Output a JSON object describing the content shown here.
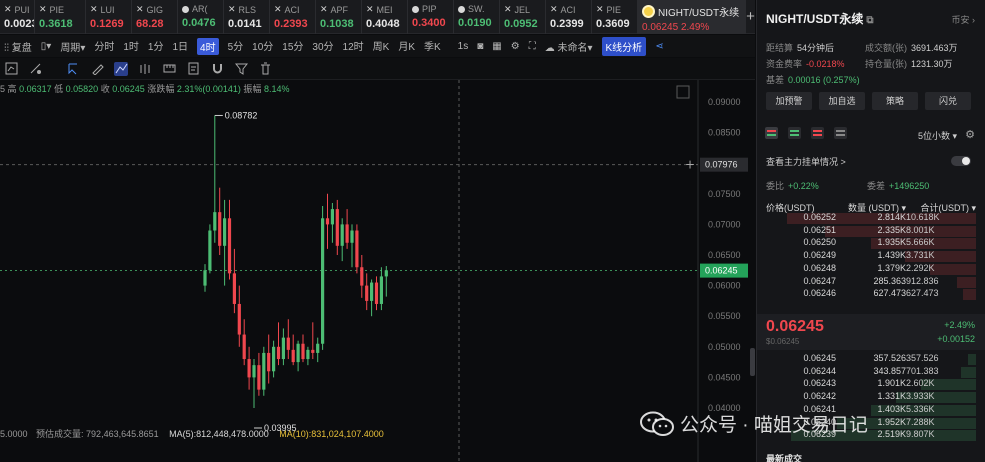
{
  "tabs": [
    {
      "mark": "x",
      "sym": "PUI",
      "price": "0.0023",
      "color": "#e6e6e6"
    },
    {
      "mark": "x",
      "sym": "PIE",
      "price": "0.3618",
      "color": "#4dbd74"
    },
    {
      "mark": "x",
      "sym": "LUI",
      "price": "0.1269",
      "color": "#f0474e"
    },
    {
      "mark": "x",
      "sym": "GIG",
      "price": "68.28",
      "color": "#f0474e"
    },
    {
      "mark": "dot",
      "sym": "AR(",
      "price": "0.0476",
      "color": "#4dbd74"
    },
    {
      "mark": "x",
      "sym": "RLS",
      "price": "0.0141",
      "color": "#e6e6e6"
    },
    {
      "mark": "x",
      "sym": "ACI",
      "price": "0.2393",
      "color": "#f0474e"
    },
    {
      "mark": "x",
      "sym": "APF",
      "price": "0.1038",
      "color": "#4dbd74"
    },
    {
      "mark": "x",
      "sym": "MEI",
      "price": "0.4048",
      "color": "#e6e6e6"
    },
    {
      "mark": "dot",
      "sym": "PIP",
      "price": "0.3400",
      "color": "#f0474e"
    },
    {
      "mark": "dot",
      "sym": "SW.",
      "price": "0.0190",
      "color": "#4dbd74"
    },
    {
      "mark": "x",
      "sym": "JEL",
      "price": "0.0952",
      "color": "#4dbd74"
    },
    {
      "mark": "x",
      "sym": "ACI",
      "price": "0.2399",
      "color": "#e6e6e6"
    },
    {
      "mark": "x",
      "sym": "PIE",
      "price": "0.3609",
      "color": "#e6e6e6"
    }
  ],
  "active_tab": {
    "sym": "NIGHT/USDT永续",
    "price": "0.06245",
    "pct": "2.49%"
  },
  "tab_add": "+",
  "toolbar": {
    "replay": "复盘",
    "period": "周期",
    "intervals": [
      "分时",
      "1时",
      "1分",
      "1日",
      "4时",
      "5分",
      "10分",
      "15分",
      "30分",
      "12时",
      "周K",
      "月K",
      "季K"
    ],
    "selected_interval": "4时",
    "one_s": "1s",
    "unnamed": "未命名",
    "k_analysis": "K线分析"
  },
  "ohlc": {
    "high_label": "高",
    "high": "0.06317",
    "low_label": "低",
    "low": "0.05820",
    "close_label": "收",
    "close": "0.06245",
    "pct_label": "涨跌幅",
    "pct": "2.31%(0.00141)",
    "amp_label": "振幅",
    "amp": "8.14%",
    "prefix": "5"
  },
  "chart_data": {
    "type": "candlestick",
    "ylim": [
      0.04,
      0.09
    ],
    "yticks": [
      "0.09000",
      "0.08500",
      "0.08000",
      "0.07500",
      "0.07000",
      "0.06500",
      "0.06000",
      "0.05500",
      "0.05000",
      "0.04500",
      "0.04000"
    ],
    "y_tick_values": [
      0.09,
      0.085,
      0.08,
      0.075,
      0.07,
      0.065,
      0.06,
      0.055,
      0.05,
      0.045,
      0.04
    ],
    "crosshair_price": "0.07976",
    "last_price": "0.06245",
    "max_label": "0.08782",
    "min_label": "0.03995",
    "candles": [
      [
        0.06,
        0.0635,
        0.059,
        0.0625
      ],
      [
        0.0625,
        0.07,
        0.062,
        0.069
      ],
      [
        0.069,
        0.0878,
        0.067,
        0.072
      ],
      [
        0.072,
        0.076,
        0.065,
        0.0665
      ],
      [
        0.0665,
        0.074,
        0.06,
        0.071
      ],
      [
        0.071,
        0.074,
        0.061,
        0.062
      ],
      [
        0.062,
        0.066,
        0.0555,
        0.057
      ],
      [
        0.057,
        0.06,
        0.05,
        0.052
      ],
      [
        0.052,
        0.0545,
        0.047,
        0.048
      ],
      [
        0.048,
        0.05,
        0.043,
        0.045
      ],
      [
        0.045,
        0.048,
        0.04,
        0.047
      ],
      [
        0.047,
        0.049,
        0.042,
        0.043
      ],
      [
        0.043,
        0.05,
        0.042,
        0.049
      ],
      [
        0.049,
        0.052,
        0.044,
        0.046
      ],
      [
        0.046,
        0.051,
        0.045,
        0.05
      ],
      [
        0.05,
        0.054,
        0.047,
        0.048
      ],
      [
        0.048,
        0.053,
        0.047,
        0.0515
      ],
      [
        0.0515,
        0.0545,
        0.048,
        0.0495
      ],
      [
        0.0495,
        0.052,
        0.047,
        0.0475
      ],
      [
        0.0475,
        0.051,
        0.046,
        0.0505
      ],
      [
        0.0505,
        0.052,
        0.0475,
        0.048
      ],
      [
        0.048,
        0.05,
        0.047,
        0.0495
      ],
      [
        0.0495,
        0.054,
        0.048,
        0.049
      ],
      [
        0.049,
        0.0515,
        0.0475,
        0.0505
      ],
      [
        0.0505,
        0.073,
        0.0495,
        0.071
      ],
      [
        0.071,
        0.075,
        0.066,
        0.07
      ],
      [
        0.07,
        0.0735,
        0.067,
        0.0725
      ],
      [
        0.0725,
        0.074,
        0.065,
        0.0665
      ],
      [
        0.0665,
        0.071,
        0.064,
        0.07
      ],
      [
        0.07,
        0.0725,
        0.066,
        0.067
      ],
      [
        0.067,
        0.07,
        0.063,
        0.069
      ],
      [
        0.069,
        0.07,
        0.062,
        0.063
      ],
      [
        0.063,
        0.065,
        0.058,
        0.06
      ],
      [
        0.06,
        0.062,
        0.056,
        0.0575
      ],
      [
        0.0575,
        0.061,
        0.055,
        0.0605
      ],
      [
        0.0605,
        0.0615,
        0.056,
        0.057
      ],
      [
        0.057,
        0.063,
        0.056,
        0.0615
      ],
      [
        0.0615,
        0.0632,
        0.0582,
        0.0625
      ]
    ]
  },
  "volume_line": {
    "prefix": "5.0000",
    "label": "预估成交量: 792,463,645.8651",
    "ma5": "MA(5):812,448,478.0000",
    "ma10": "MA(10):831,024,107.4000"
  },
  "panel": {
    "title": "NIGHT/USDT永续",
    "currency": "币安",
    "stats": [
      {
        "label": "距结算",
        "value": "54分钟后",
        "tone": "plain",
        "col": 0
      },
      {
        "label": "成交额(张)",
        "value": "3691.463万",
        "tone": "plain",
        "col": 1
      },
      {
        "label": "资金费率",
        "value": "-0.0218%",
        "tone": "red",
        "col": 0
      },
      {
        "label": "持仓量(张)",
        "value": "1231.30万",
        "tone": "plain",
        "col": 1
      },
      {
        "label": "基差",
        "value": "0.00016 (0.257%)",
        "tone": "green",
        "col": 0
      }
    ],
    "buttons": [
      "加预警",
      "加自选",
      "策略",
      "闪兑"
    ],
    "decimals": "5位小数",
    "mainforce": "查看主力挂单情况 >",
    "ratio_label": "委比",
    "ratio": "+0.22%",
    "diff_label": "委差",
    "diff": "+1496250",
    "ob_head": [
      "价格(USDT)",
      "数量 (USDT)",
      "合计(USDT)"
    ],
    "asks": [
      {
        "price": "0.06252",
        "qty": "2.814K",
        "total": "10.618K",
        "w": 0.9
      },
      {
        "price": "0.06251",
        "qty": "2.335K",
        "total": "8.001K",
        "w": 0.72
      },
      {
        "price": "0.06250",
        "qty": "1.935K",
        "total": "5.666K",
        "w": 0.5
      },
      {
        "price": "0.06249",
        "qty": "1.439K",
        "total": "3.731K",
        "w": 0.34
      },
      {
        "price": "0.06248",
        "qty": "1.379K",
        "total": "2.292K",
        "w": 0.22
      },
      {
        "price": "0.06247",
        "qty": "285.363",
        "total": "912.836",
        "w": 0.09
      },
      {
        "price": "0.06246",
        "qty": "627.473",
        "total": "627.473",
        "w": 0.06
      }
    ],
    "last": {
      "price": "0.06245",
      "sub": "$0.06245",
      "pct": "+2.49%",
      "chg": "+0.00152"
    },
    "bids": [
      {
        "price": "0.06245",
        "qty": "357.526",
        "total": "357.526",
        "w": 0.04
      },
      {
        "price": "0.06244",
        "qty": "343.857",
        "total": "701.383",
        "w": 0.07
      },
      {
        "price": "0.06243",
        "qty": "1.901K",
        "total": "2.602K",
        "w": 0.26
      },
      {
        "price": "0.06242",
        "qty": "1.331K",
        "total": "3.933K",
        "w": 0.38
      },
      {
        "price": "0.06241",
        "qty": "1.403K",
        "total": "5.336K",
        "w": 0.5
      },
      {
        "price": "0.06240",
        "qty": "1.952K",
        "total": "7.288K",
        "w": 0.66
      },
      {
        "price": "0.06239",
        "qty": "2.519K",
        "total": "9.807K",
        "w": 0.88
      }
    ],
    "latest_trades": "最新成交"
  },
  "watermark": "公众号 · 喵姐交易日记",
  "colors": {
    "up": "#4dbd74",
    "down": "#f0474e",
    "accent": "#3a5bd9"
  }
}
